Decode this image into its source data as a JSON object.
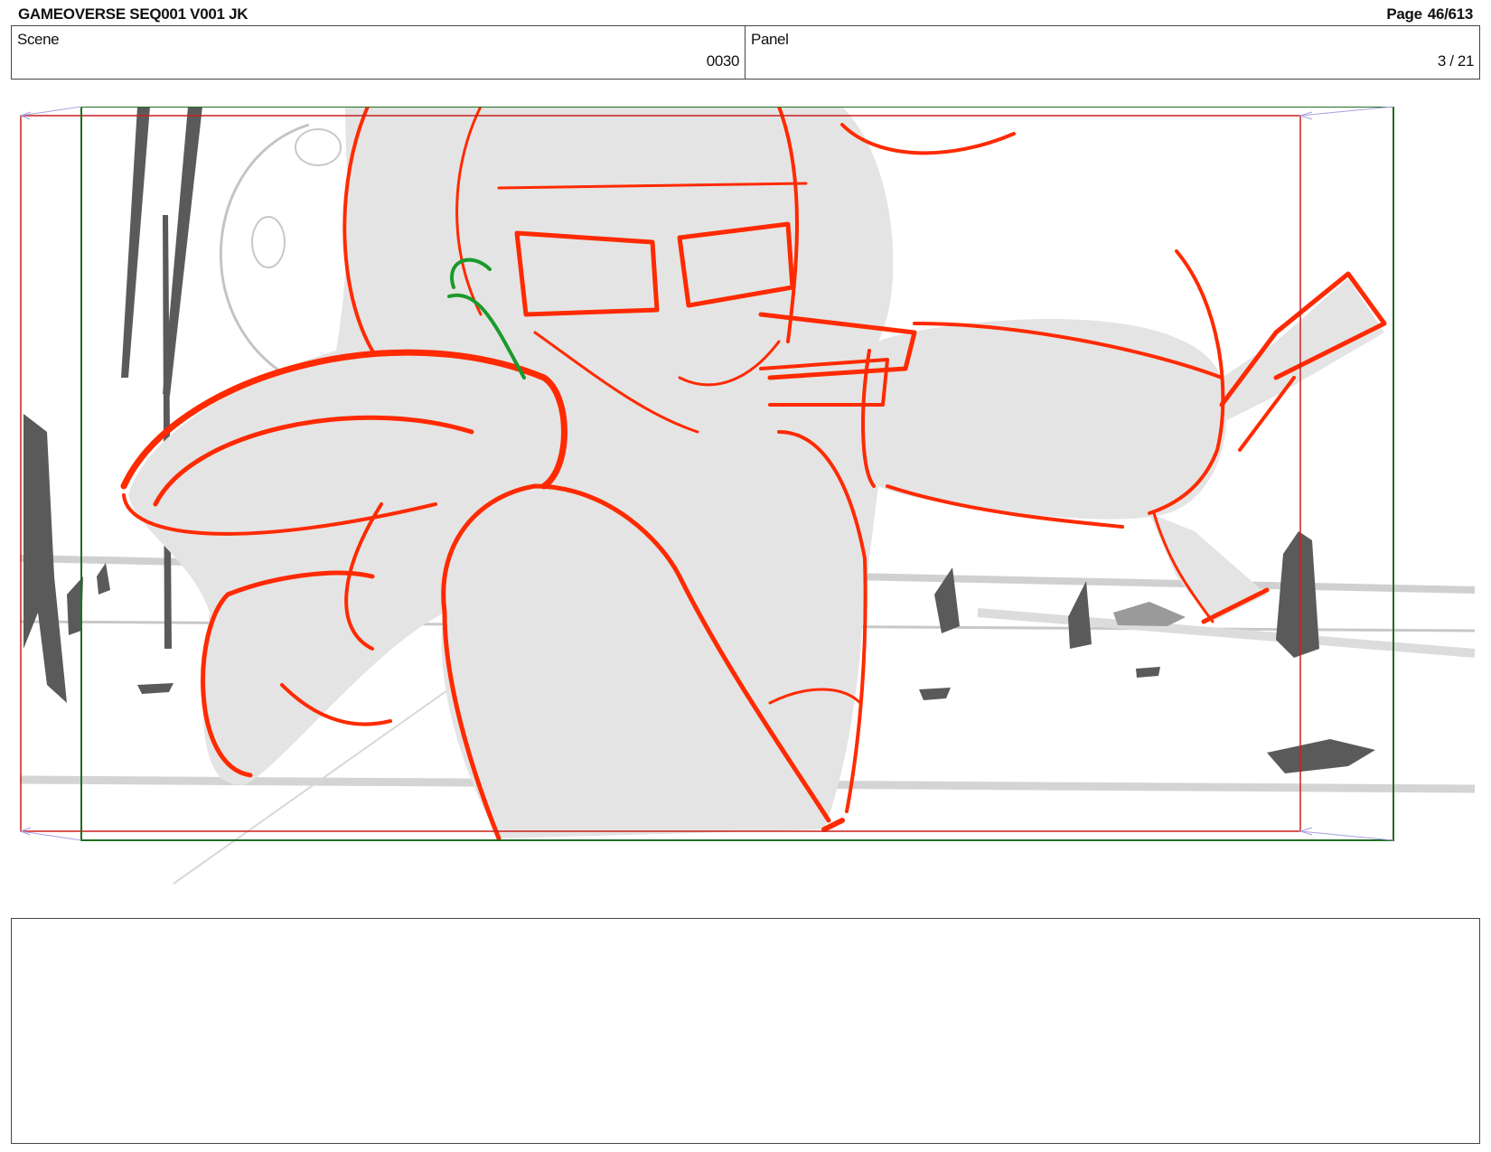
{
  "header": {
    "title": "GAMEOVERSE SEQ001 V001 JK",
    "page_label": "Page",
    "page_value": "46/613"
  },
  "info": {
    "scene_label": "Scene",
    "scene_value": "0030",
    "panel_label": "Panel",
    "panel_value": "3 / 21"
  },
  "notes": {
    "text": ""
  },
  "colors": {
    "sketch_red": "#ff2a00",
    "sketch_green": "#1a9a2a",
    "fill_gray": "#e4e4e4",
    "bg_gray": "#bdbdbd",
    "rock_dark": "#5a5a5a",
    "frame_red": "#cc1f1f",
    "frame_green": "#1f6e1f",
    "arrow_purple": "#a8a0e0"
  }
}
